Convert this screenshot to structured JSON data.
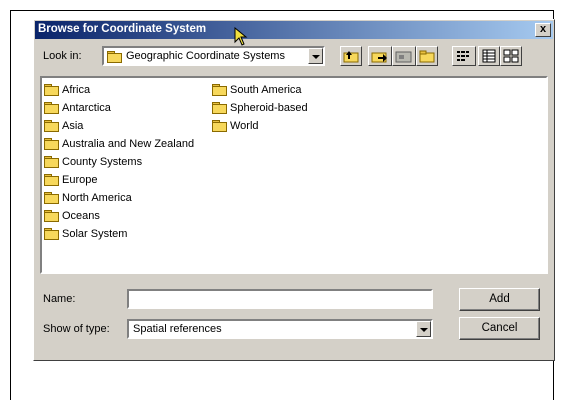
{
  "dialog": {
    "title": "Browse for Coordinate System",
    "close_glyph": "x"
  },
  "look_in": {
    "label": "Look in:",
    "value": "Geographic Coordinate Systems"
  },
  "toolbar": {
    "icons": [
      "up-one-level-icon",
      "add-to-favorites-icon",
      "connect-folder-icon",
      "new-folder-icon",
      "list-view-icon",
      "details-view-icon",
      "thumbnails-view-icon"
    ]
  },
  "files": {
    "column1": [
      "Africa",
      "Antarctica",
      "Asia",
      "Australia and New Zealand",
      "County Systems",
      "Europe",
      "North America",
      "Oceans",
      "Solar System"
    ],
    "column2": [
      "South America",
      "Spheroid-based",
      "World"
    ]
  },
  "name_field": {
    "label": "Name:",
    "value": ""
  },
  "type_field": {
    "label": "Show of type:",
    "value": "Spatial references"
  },
  "buttons": {
    "add": "Add",
    "cancel": "Cancel"
  }
}
